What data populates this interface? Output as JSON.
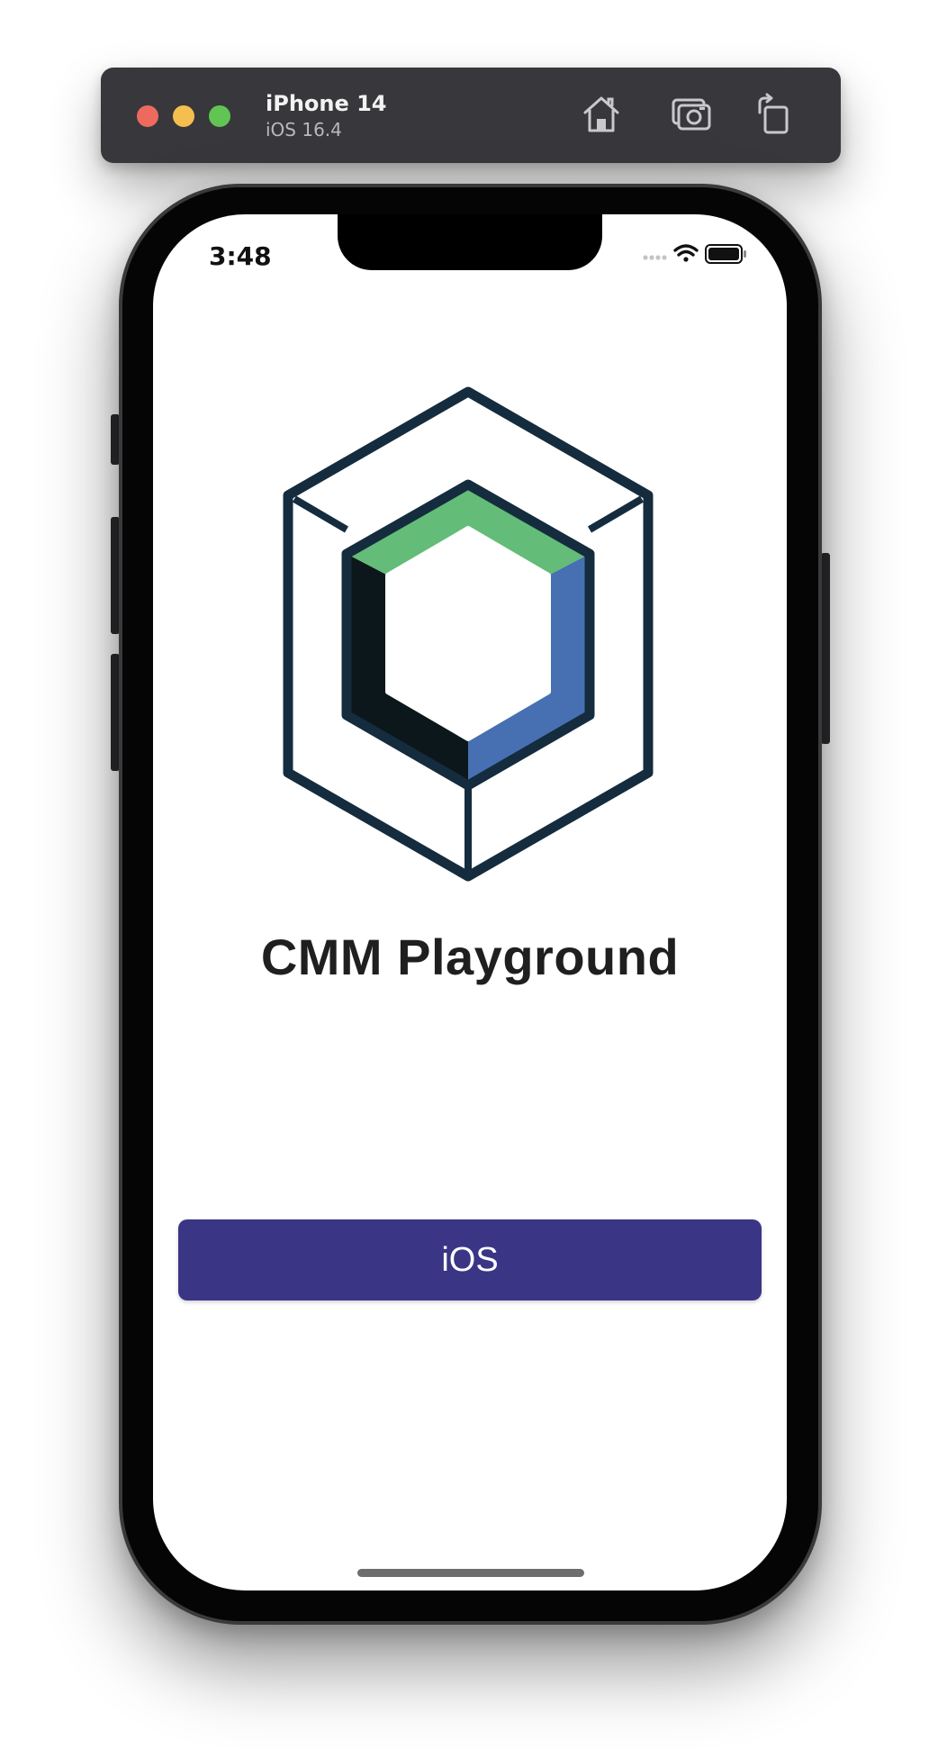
{
  "simulator": {
    "device_name": "iPhone 14",
    "os_version": "iOS 16.4",
    "toolbar_icons": [
      "home-icon",
      "screenshot-icon",
      "rotate-icon"
    ],
    "window_controls": [
      "close",
      "minimize",
      "zoom"
    ]
  },
  "status_bar": {
    "time": "3:48",
    "icons": [
      "cellular-signal-icon",
      "wifi-icon",
      "battery-icon"
    ]
  },
  "app": {
    "logo_icon": "cmm-cube-logo-icon",
    "title": "CMM Playground",
    "button_label": "iOS"
  },
  "colors": {
    "button": "#3b3586",
    "logo_outline": "#152c3e",
    "logo_green": "#63bc78",
    "logo_blue": "#4670b2",
    "logo_dark": "#0b171b"
  }
}
